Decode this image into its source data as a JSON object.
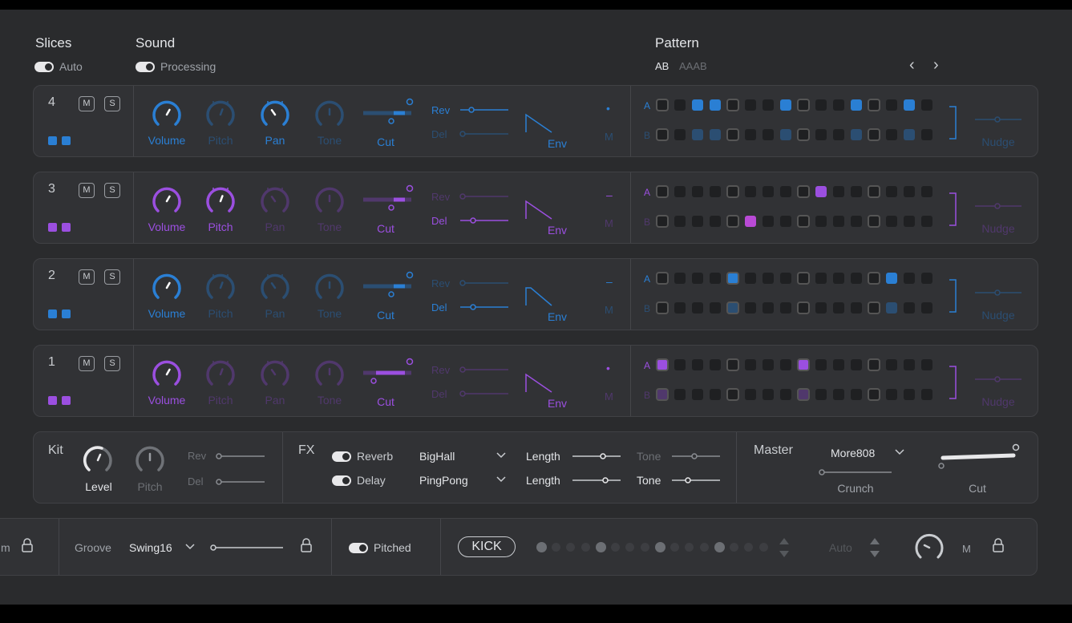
{
  "header": {
    "slices_title": "Slices",
    "slices_toggle": "Auto",
    "sound_title": "Sound",
    "sound_toggle": "Processing",
    "pattern_title": "Pattern",
    "pattern_ab": "AB",
    "pattern_aaab": "AAAB",
    "prev": "‹",
    "next": "›"
  },
  "labels": {
    "mute": "M",
    "solo": "S",
    "volume": "Volume",
    "pitch": "Pitch",
    "pan": "Pan",
    "tone": "Tone",
    "cut": "Cut",
    "rev": "Rev",
    "del": "Del",
    "env": "Env",
    "m": "M",
    "row_a": "A",
    "row_b": "B",
    "nudge": "Nudge"
  },
  "colors": {
    "blue": "#2a7fd4",
    "purple": "#9b4fe0",
    "magenta": "#b94ad6"
  },
  "tracks": [
    {
      "number": "4",
      "color": "blue",
      "dot": "•",
      "pattern_a": [
        0,
        0,
        1,
        1,
        0,
        0,
        0,
        1,
        0,
        0,
        0,
        1,
        0,
        0,
        1,
        0
      ],
      "pattern_b": [
        0,
        0,
        1,
        1,
        0,
        0,
        0,
        1,
        0,
        0,
        0,
        1,
        0,
        0,
        1,
        0
      ]
    },
    {
      "number": "3",
      "color": "purple",
      "dot": "–",
      "pattern_a": [
        0,
        0,
        0,
        0,
        0,
        0,
        0,
        0,
        0,
        1,
        0,
        0,
        0,
        0,
        0,
        0
      ],
      "pattern_b": [
        0,
        0,
        0,
        0,
        0,
        1,
        0,
        0,
        0,
        0,
        0,
        0,
        0,
        0,
        0,
        0
      ]
    },
    {
      "number": "2",
      "color": "blue",
      "dot": "–",
      "pattern_a": [
        0,
        0,
        0,
        0,
        1,
        0,
        0,
        0,
        0,
        0,
        0,
        0,
        0,
        1,
        0,
        0
      ],
      "pattern_b": [
        0,
        0,
        0,
        0,
        1,
        0,
        0,
        0,
        0,
        0,
        0,
        0,
        0,
        1,
        0,
        0
      ]
    },
    {
      "number": "1",
      "color": "purple",
      "dot": "•",
      "pattern_a": [
        1,
        0,
        0,
        0,
        0,
        0,
        0,
        0,
        1,
        0,
        0,
        0,
        0,
        0,
        0,
        0
      ],
      "pattern_b": [
        1,
        0,
        0,
        0,
        0,
        0,
        0,
        0,
        1,
        0,
        0,
        0,
        0,
        0,
        0,
        0
      ]
    }
  ],
  "kit": {
    "title": "Kit",
    "level": "Level",
    "pitch": "Pitch",
    "rev": "Rev",
    "del": "Del"
  },
  "fx": {
    "title": "FX",
    "reverb": "Reverb",
    "reverb_preset": "BigHall",
    "delay": "Delay",
    "delay_preset": "PingPong",
    "length": "Length",
    "tone": "Tone"
  },
  "master": {
    "title": "Master",
    "preset": "More808",
    "crunch": "Crunch",
    "cut": "Cut"
  },
  "bottom": {
    "partial_label": "m",
    "groove_label": "Groove",
    "groove_value": "Swing16",
    "pitched": "Pitched",
    "kick": "KICK",
    "auto": "Auto",
    "m": "M"
  }
}
